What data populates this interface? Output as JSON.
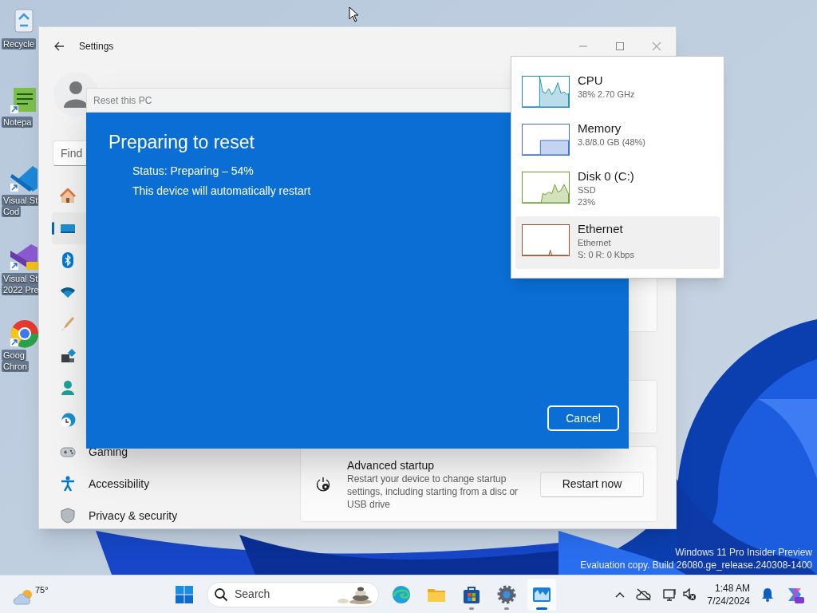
{
  "desktop_icons": [
    {
      "lines": [
        "Recycle"
      ]
    },
    {
      "lines": [
        "Notepa"
      ]
    },
    {
      "lines": [
        "Visual St",
        "Cod"
      ]
    },
    {
      "lines": [
        "Visual St",
        "2022 Pre"
      ]
    },
    {
      "lines": [
        "Goog",
        "Chron"
      ]
    }
  ],
  "settings": {
    "title": "Settings",
    "search": {
      "placeholder": "Find"
    },
    "nav": [
      {
        "selected": false
      },
      {
        "selected": true
      },
      {
        "selected": false
      },
      {
        "selected": false
      },
      {
        "selected": false
      },
      {
        "selected": false
      },
      {
        "selected": false
      },
      {
        "selected": false
      },
      {
        "label": "Gaming",
        "selected": false
      },
      {
        "label": "Accessibility",
        "selected": false
      },
      {
        "label": "Privacy & security",
        "selected": false
      }
    ],
    "advanced_startup": {
      "title": "Advanced startup",
      "description": "Restart your device to change startup settings, including starting from a disc or USB drive",
      "button": "Restart now"
    }
  },
  "reset_dialog": {
    "title": "Reset this PC",
    "heading": "Preparing to reset",
    "lines": [
      "Status: Preparing – 54%",
      "This device will automatically restart"
    ],
    "button": "Cancel"
  },
  "performance": [
    {
      "name": "CPU",
      "details": [
        "38% 2.70 GHz"
      ],
      "color": "#1f8fb5",
      "selected": false
    },
    {
      "name": "Memory",
      "details": [
        "3.8/8.0 GB (48%)"
      ],
      "color": "#3b6fd0",
      "selected": false
    },
    {
      "name": "Disk 0 (C:)",
      "details": [
        "SSD",
        "23%"
      ],
      "color": "#6aa02a",
      "selected": false
    },
    {
      "name": "Ethernet",
      "details": [
        "Ethernet",
        "S: 0 R: 0 Kbps"
      ],
      "color": "#a0522d",
      "selected": true
    }
  ],
  "watermark": [
    "Windows 11 Pro Insider Preview",
    "Evaluation copy. Build 26080.ge_release.240308-1400"
  ],
  "taskbar": {
    "weather": "75°",
    "search": {
      "placeholder": "Search"
    },
    "apps": [
      {
        "running": false,
        "active": false
      },
      {
        "running": false,
        "active": false
      },
      {
        "running": true,
        "active": false
      },
      {
        "running": true,
        "active": false
      },
      {
        "running": true,
        "active": true
      }
    ],
    "time": "1:48 AM",
    "date": "7/24/2024"
  }
}
